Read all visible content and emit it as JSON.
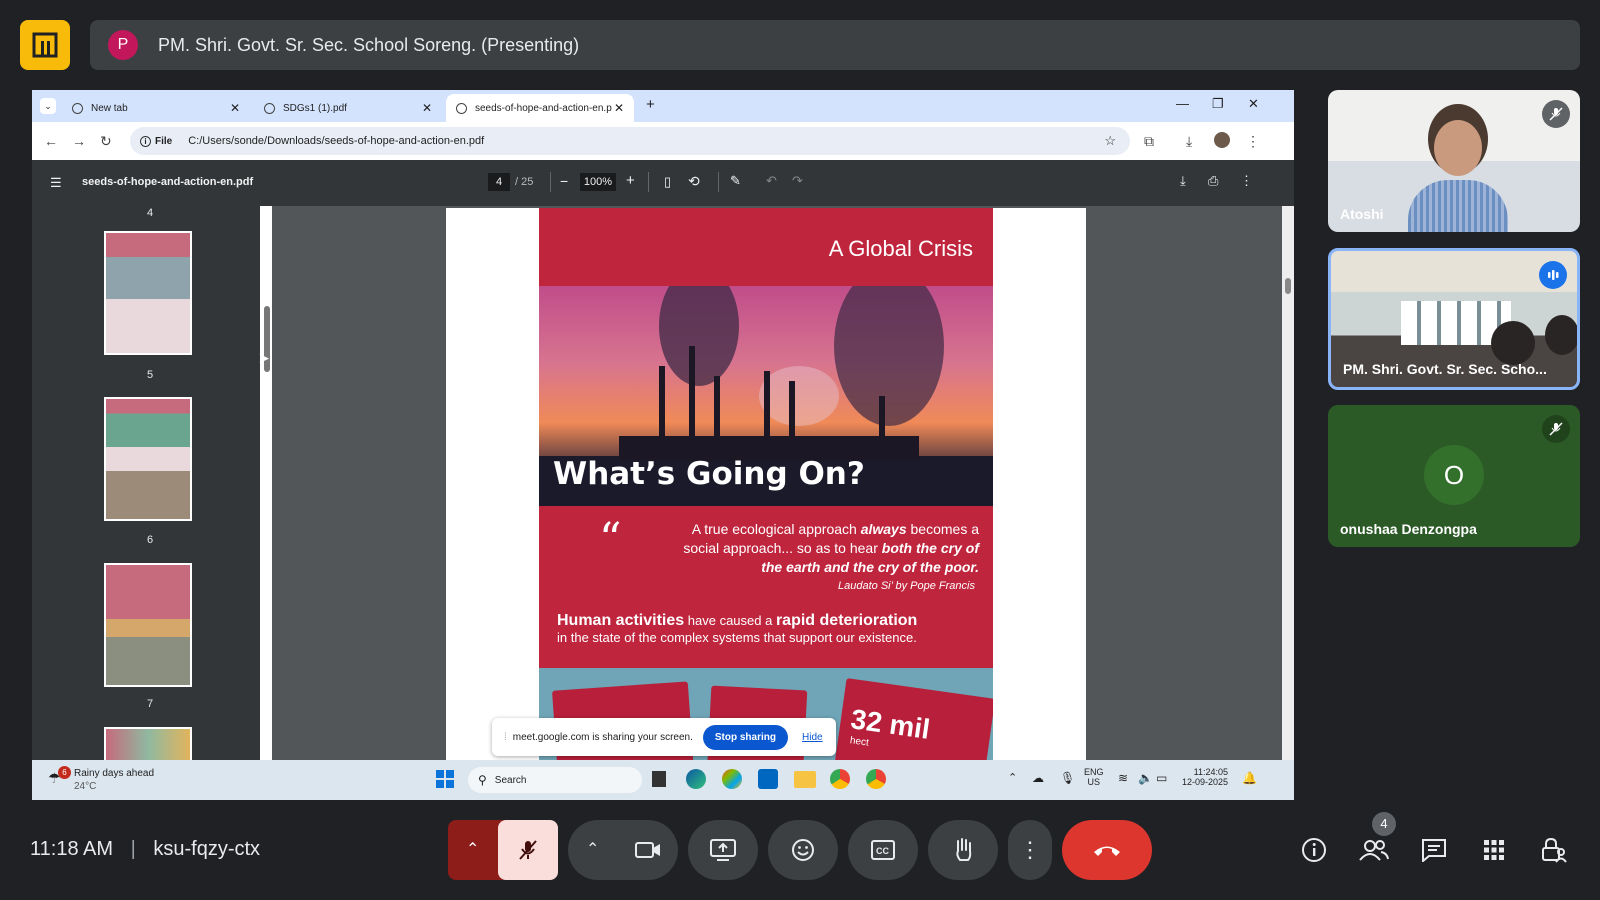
{
  "meet": {
    "presenter_initial": "P",
    "presenter_title": "PM. Shri. Govt. Sr. Sec. School Soreng. (Presenting)",
    "clock": "11:18 AM",
    "separator": "|",
    "meeting_code": "ksu-fqzy-ctx",
    "participants_count": "4"
  },
  "participants": [
    {
      "name": "Atoshi",
      "muted": true
    },
    {
      "name": "PM. Shri. Govt. Sr. Sec. Scho...",
      "speaking": true
    },
    {
      "name": "onushaa Denzongpa",
      "initial": "O",
      "muted": true
    }
  ],
  "browser": {
    "tabs": [
      {
        "label": "New tab",
        "close": "✕"
      },
      {
        "label": "SDGs1 (1).pdf",
        "close": "✕"
      },
      {
        "label": "seeds-of-hope-and-action-en.p",
        "close": "✕"
      }
    ],
    "new_tab": "+",
    "file_chip": "File",
    "url": "C:/Users/sonde/Downloads/seeds-of-hope-and-action-en.pdf"
  },
  "pdf": {
    "filename": "seeds-of-hope-and-action-en.pdf",
    "current_page": "4",
    "total_pages": "/ 25",
    "zoom": "100%",
    "thumbnails": [
      "4",
      "5",
      "6",
      "7"
    ],
    "page": {
      "crisis_label": "A Global Crisis",
      "headline": "What’s Going On?",
      "quote_mark": "“",
      "quote_line1_a": "A true ecological approach ",
      "quote_line1_b": "always",
      "quote_line1_c": " becomes a",
      "quote_line2_a": "social approach... so as to hear ",
      "quote_line2_b": "both the cry of",
      "quote_line3": "the earth and the cry of the poor.",
      "quote_source": "Laudato Si’ by Pope Francis",
      "human_a": "Human activities",
      "human_b": " have caused a ",
      "human_c": "rapid deterioration",
      "human_d": "in the state of the complex systems that support our existence.",
      "stat": "32 mil",
      "stat_unit": "hect"
    }
  },
  "share_notice": {
    "message": "meet.google.com is sharing your screen.",
    "stop": "Stop sharing",
    "hide": "Hide"
  },
  "taskbar": {
    "weather_badge": "6",
    "weather_title": "Rainy days ahead",
    "weather_temp": "24°C",
    "search": "Search",
    "lang1": "ENG",
    "lang2": "US",
    "time": "11:24:05",
    "date": "12-09-2025"
  }
}
